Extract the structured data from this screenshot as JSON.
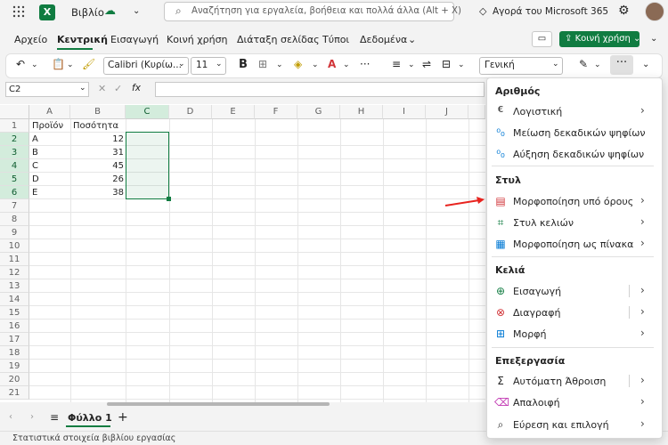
{
  "titlebar": {
    "book_title": "Βιβλίο",
    "search_placeholder": "Αναζήτηση για εργαλεία, βοήθεια και πολλά άλλα (Alt + X)",
    "ms365_label": "Αγορά του Microsoft 365",
    "app_letter": "X"
  },
  "menu_tabs": [
    "Αρχείο",
    "Κεντρική",
    "Εισαγωγή",
    "Κοινή χρήση",
    "Διάταξη σελίδας",
    "Τύποι",
    "Δεδομένα"
  ],
  "share_label": "Κοινή χρήση",
  "ribbon": {
    "font_name": "Calibri (Κυρίω...",
    "font_size": "11",
    "bold": "B",
    "number_format": "Γενική",
    "more": "···"
  },
  "formula_bar": {
    "name_box": "C2",
    "fx": "fx"
  },
  "grid": {
    "columns": [
      "A",
      "B",
      "C",
      "D",
      "E",
      "F",
      "G",
      "H",
      "I",
      "J"
    ],
    "rows": [
      "1",
      "2",
      "3",
      "4",
      "5",
      "6",
      "7",
      "8",
      "9",
      "10",
      "11",
      "12",
      "13",
      "14",
      "15",
      "16",
      "17",
      "18",
      "19",
      "20",
      "21"
    ],
    "a1": "Προϊόν",
    "b1": "Ποσότητα",
    "data": [
      {
        "product": "A",
        "qty": "12"
      },
      {
        "product": "B",
        "qty": "31"
      },
      {
        "product": "C",
        "qty": "45"
      },
      {
        "product": "D",
        "qty": "26"
      },
      {
        "product": "E",
        "qty": "38"
      }
    ]
  },
  "sheet_tab": "Φύλλο 1",
  "status": "Στατιστικά στοιχεία βιβλίου εργασίας",
  "dropdown": {
    "sections": [
      {
        "title": "Αριθμός",
        "items": [
          "Λογιστική",
          "Μείωση δεκαδικών ψηφίων",
          "Αύξηση δεκαδικών ψηφίων"
        ]
      },
      {
        "title": "Στυλ",
        "items": [
          "Μορφοποίηση υπό όρους",
          "Στυλ κελιών",
          "Μορφοποίηση ως πίνακα"
        ]
      },
      {
        "title": "Κελιά",
        "items": [
          "Εισαγωγή",
          "Διαγραφή",
          "Μορφή"
        ]
      },
      {
        "title": "Επεξεργασία",
        "items": [
          "Αυτόματη Άθροιση",
          "Απαλοιφή",
          "Εύρεση και επιλογή"
        ]
      }
    ],
    "icons": {
      "accounting": "€",
      "autosum": "Σ"
    }
  },
  "colors": {
    "accent": "#107c41",
    "arrow": "#e8231e"
  }
}
